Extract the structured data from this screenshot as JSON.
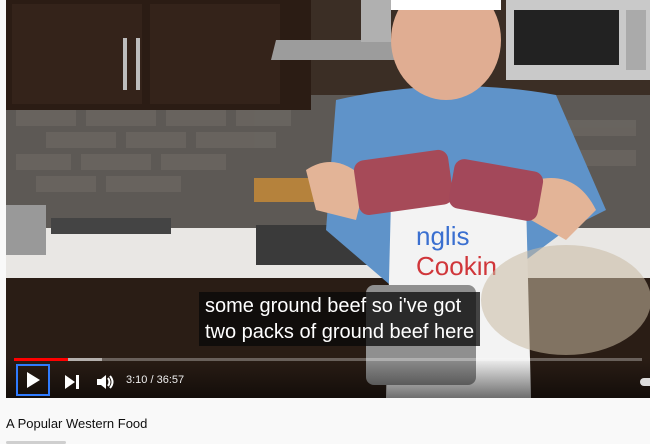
{
  "video": {
    "caption_lines": [
      "some ground beef so i've got",
      "two packs of ground beef here"
    ],
    "time_current": "3:10",
    "time_separator": " / ",
    "time_total": "36:57",
    "progress_played": 0.0857,
    "progress_loaded": 0.14,
    "apron_text": [
      "nglis",
      "Cookin"
    ]
  },
  "page": {
    "title": "A Popular Western Food"
  },
  "icons": {
    "play": "play-icon",
    "next": "next-icon",
    "volume": "volume-icon"
  },
  "colors": {
    "progress": "#ff0000",
    "focus_ring": "#2f7bff"
  }
}
